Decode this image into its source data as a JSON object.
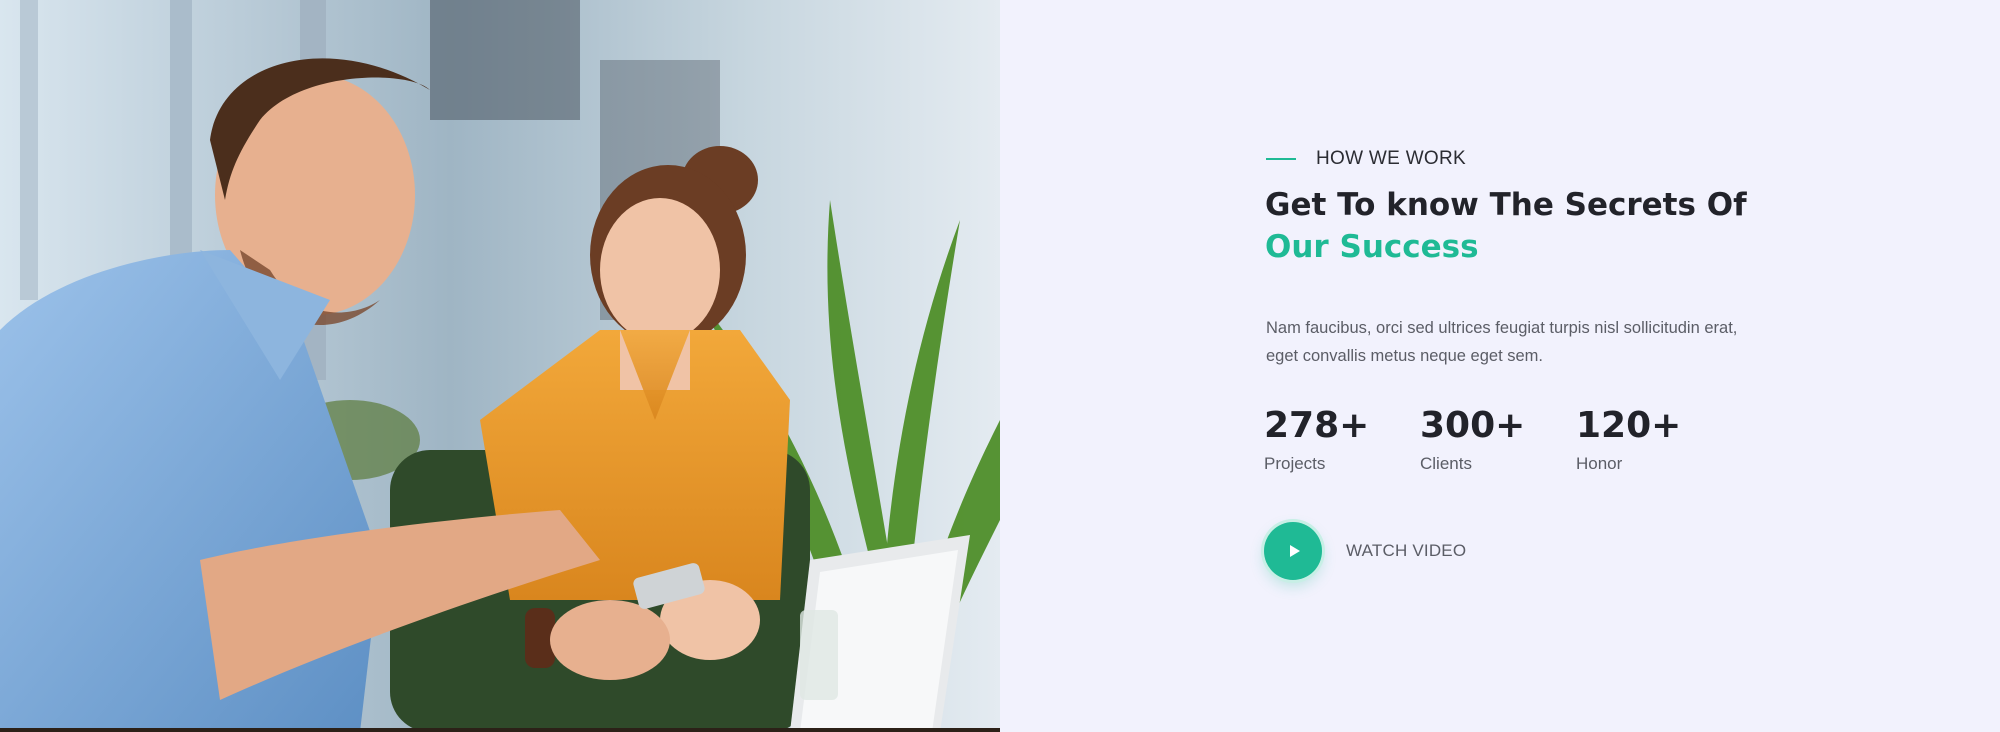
{
  "theme": {
    "accent": "#1fba95",
    "panel_background": "#f2f2fd",
    "heading_color": "#22232a",
    "text_color": "#5b5d66"
  },
  "section": {
    "eyebrow": "HOW WE WORK",
    "heading_line1": "Get To know The Secrets Of",
    "heading_accent": "Our Success",
    "description": "Nam faucibus, orci sed ultrices feugiat turpis nisl sollicitudin erat, eget convallis metus neque eget sem."
  },
  "stats": [
    {
      "value": "278+",
      "label": "Projects"
    },
    {
      "value": "300+",
      "label": "Clients"
    },
    {
      "value": "120+",
      "label": "Honor"
    }
  ],
  "video": {
    "label": "WATCH VIDEO",
    "icon": "play-icon"
  },
  "image": {
    "subject": "photo-two-colleagues-looking-at-phone"
  }
}
